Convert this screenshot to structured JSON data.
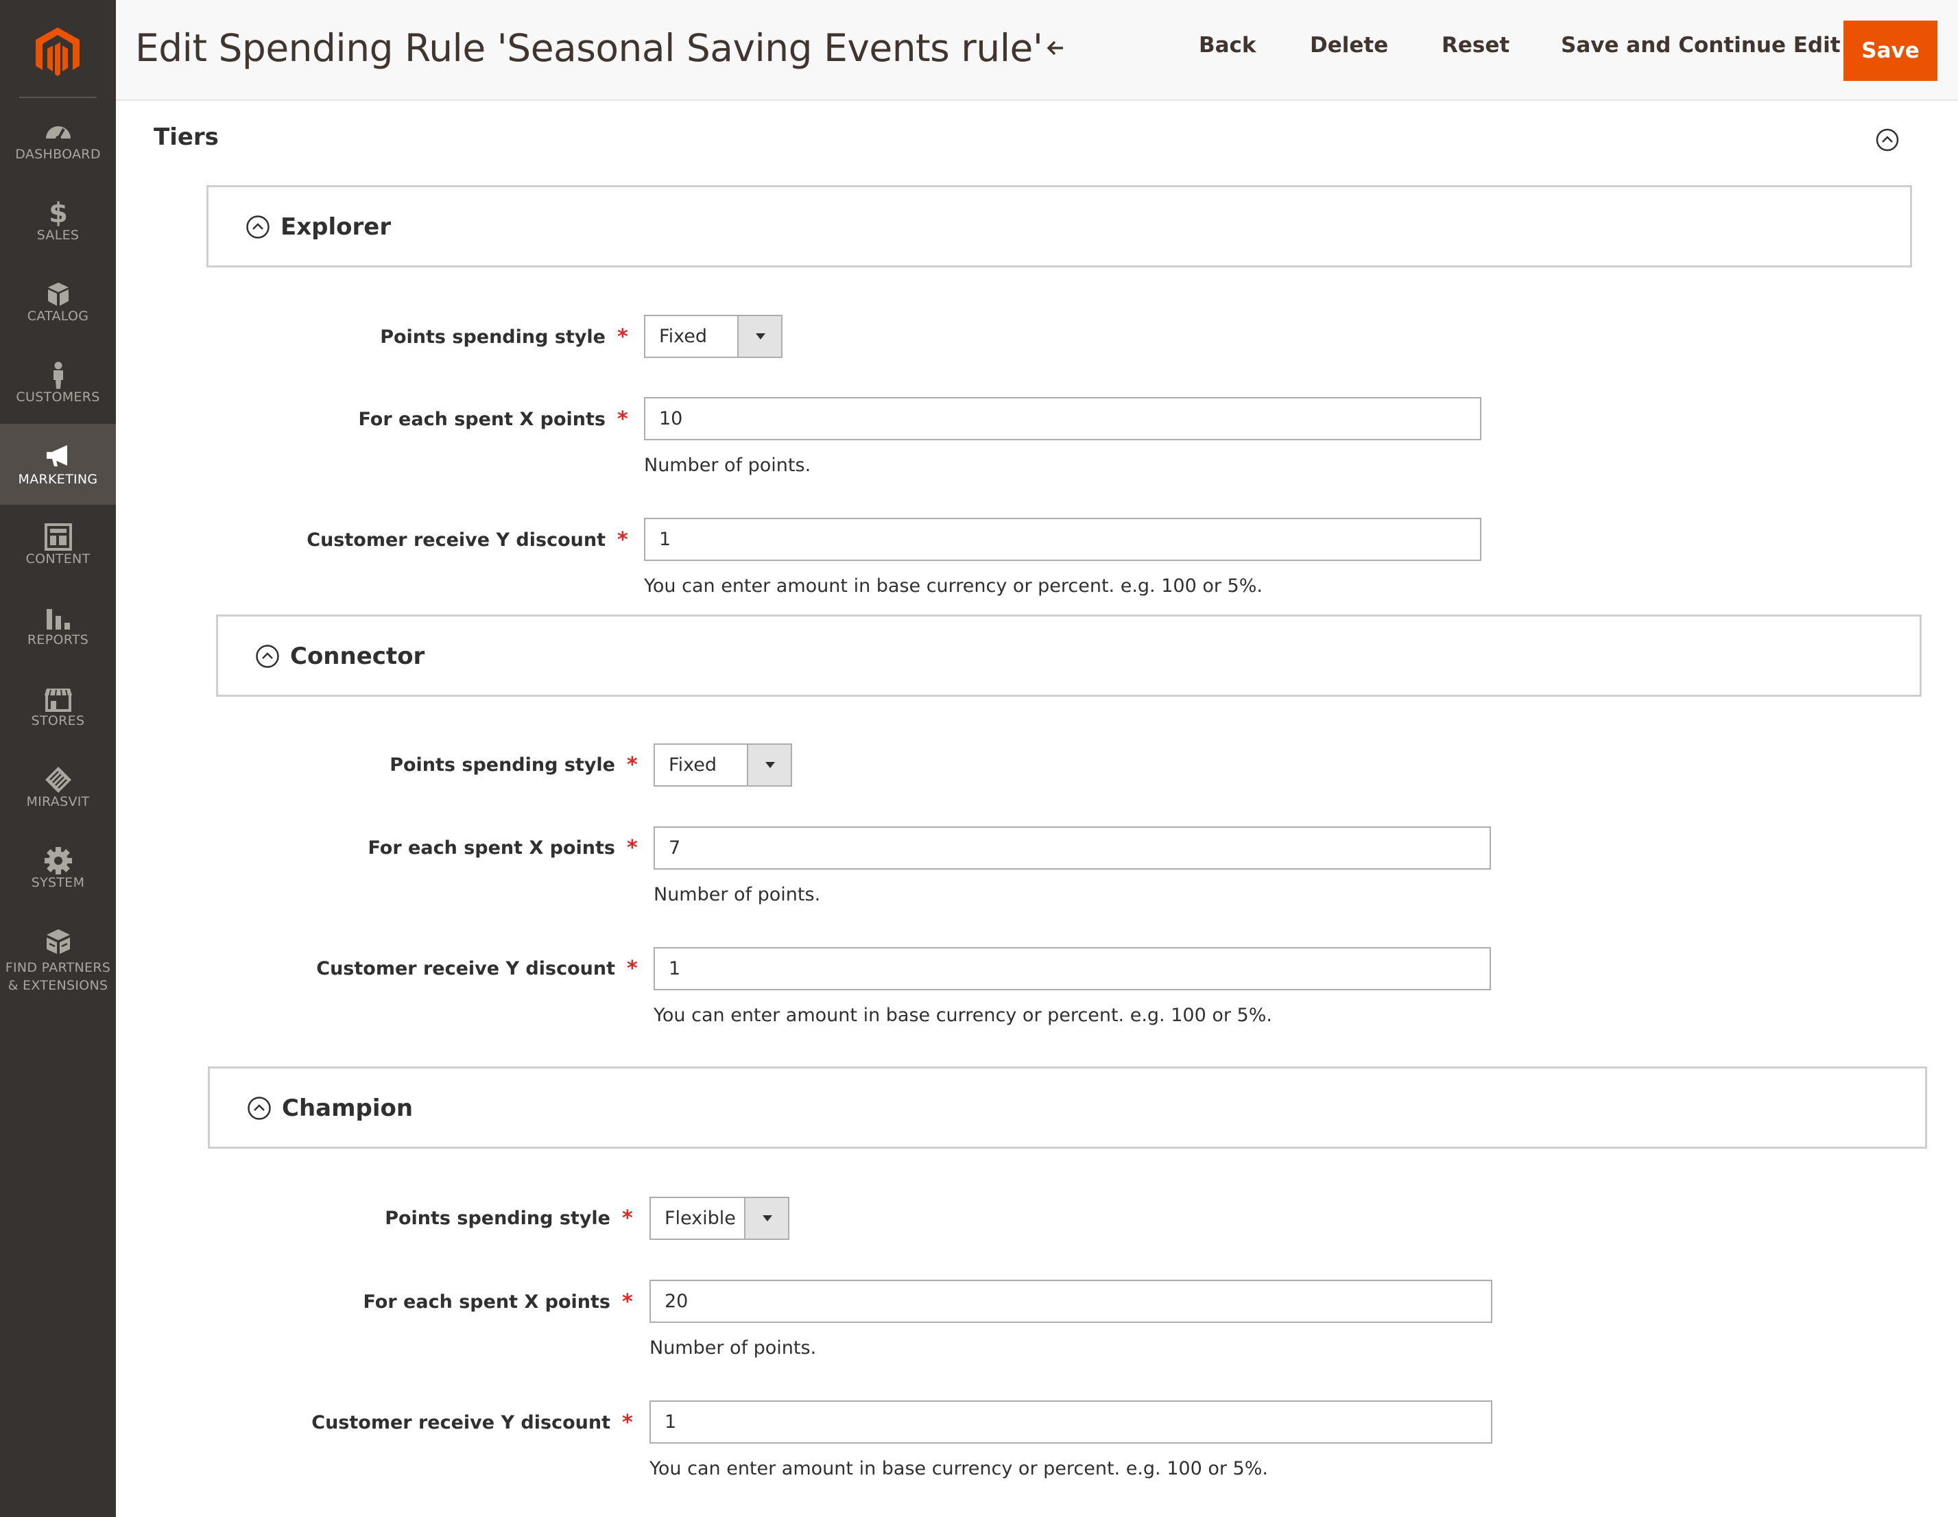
{
  "header": {
    "title": "Edit Spending Rule 'Seasonal Saving Events rule'",
    "back_label": "Back",
    "delete_label": "Delete",
    "reset_label": "Reset",
    "save_continue_label": "Save and Continue Edit",
    "save_label": "Save"
  },
  "sidebar": {
    "items": [
      {
        "label": "DASHBOARD",
        "icon": "dashboard-icon"
      },
      {
        "label": "SALES",
        "icon": "dollar-icon"
      },
      {
        "label": "CATALOG",
        "icon": "box-icon"
      },
      {
        "label": "CUSTOMERS",
        "icon": "person-icon"
      },
      {
        "label": "MARKETING",
        "icon": "megaphone-icon",
        "active": true
      },
      {
        "label": "CONTENT",
        "icon": "layout-icon"
      },
      {
        "label": "REPORTS",
        "icon": "bar-chart-icon"
      },
      {
        "label": "STORES",
        "icon": "storefront-icon"
      },
      {
        "label": "MIRASVIT",
        "icon": "mirasvit-icon"
      },
      {
        "label": "SYSTEM",
        "icon": "gear-icon"
      },
      {
        "label_line1": "FIND PARTNERS",
        "label_line2": "& EXTENSIONS",
        "icon": "blocks-icon"
      }
    ]
  },
  "section": {
    "title": "Tiers"
  },
  "labels": {
    "style": "Points spending style",
    "points": "For each spent X points",
    "discount": "Customer receive Y discount",
    "required_mark": "*",
    "points_note": "Number of points.",
    "discount_note": "You can enter amount in base currency or percent. e.g. 100 or 5%."
  },
  "tiers": [
    {
      "name": "Explorer",
      "style": "Fixed",
      "points": "10",
      "discount": "1"
    },
    {
      "name": "Connector",
      "style": "Fixed",
      "points": "7",
      "discount": "1"
    },
    {
      "name": "Champion",
      "style": "Flexible",
      "points": "20",
      "discount": "1"
    }
  ],
  "colors": {
    "sidebar_bg": "#373330",
    "sidebar_active": "#524d49",
    "brand_orange": "#eb5202",
    "required_red": "#e22626"
  }
}
